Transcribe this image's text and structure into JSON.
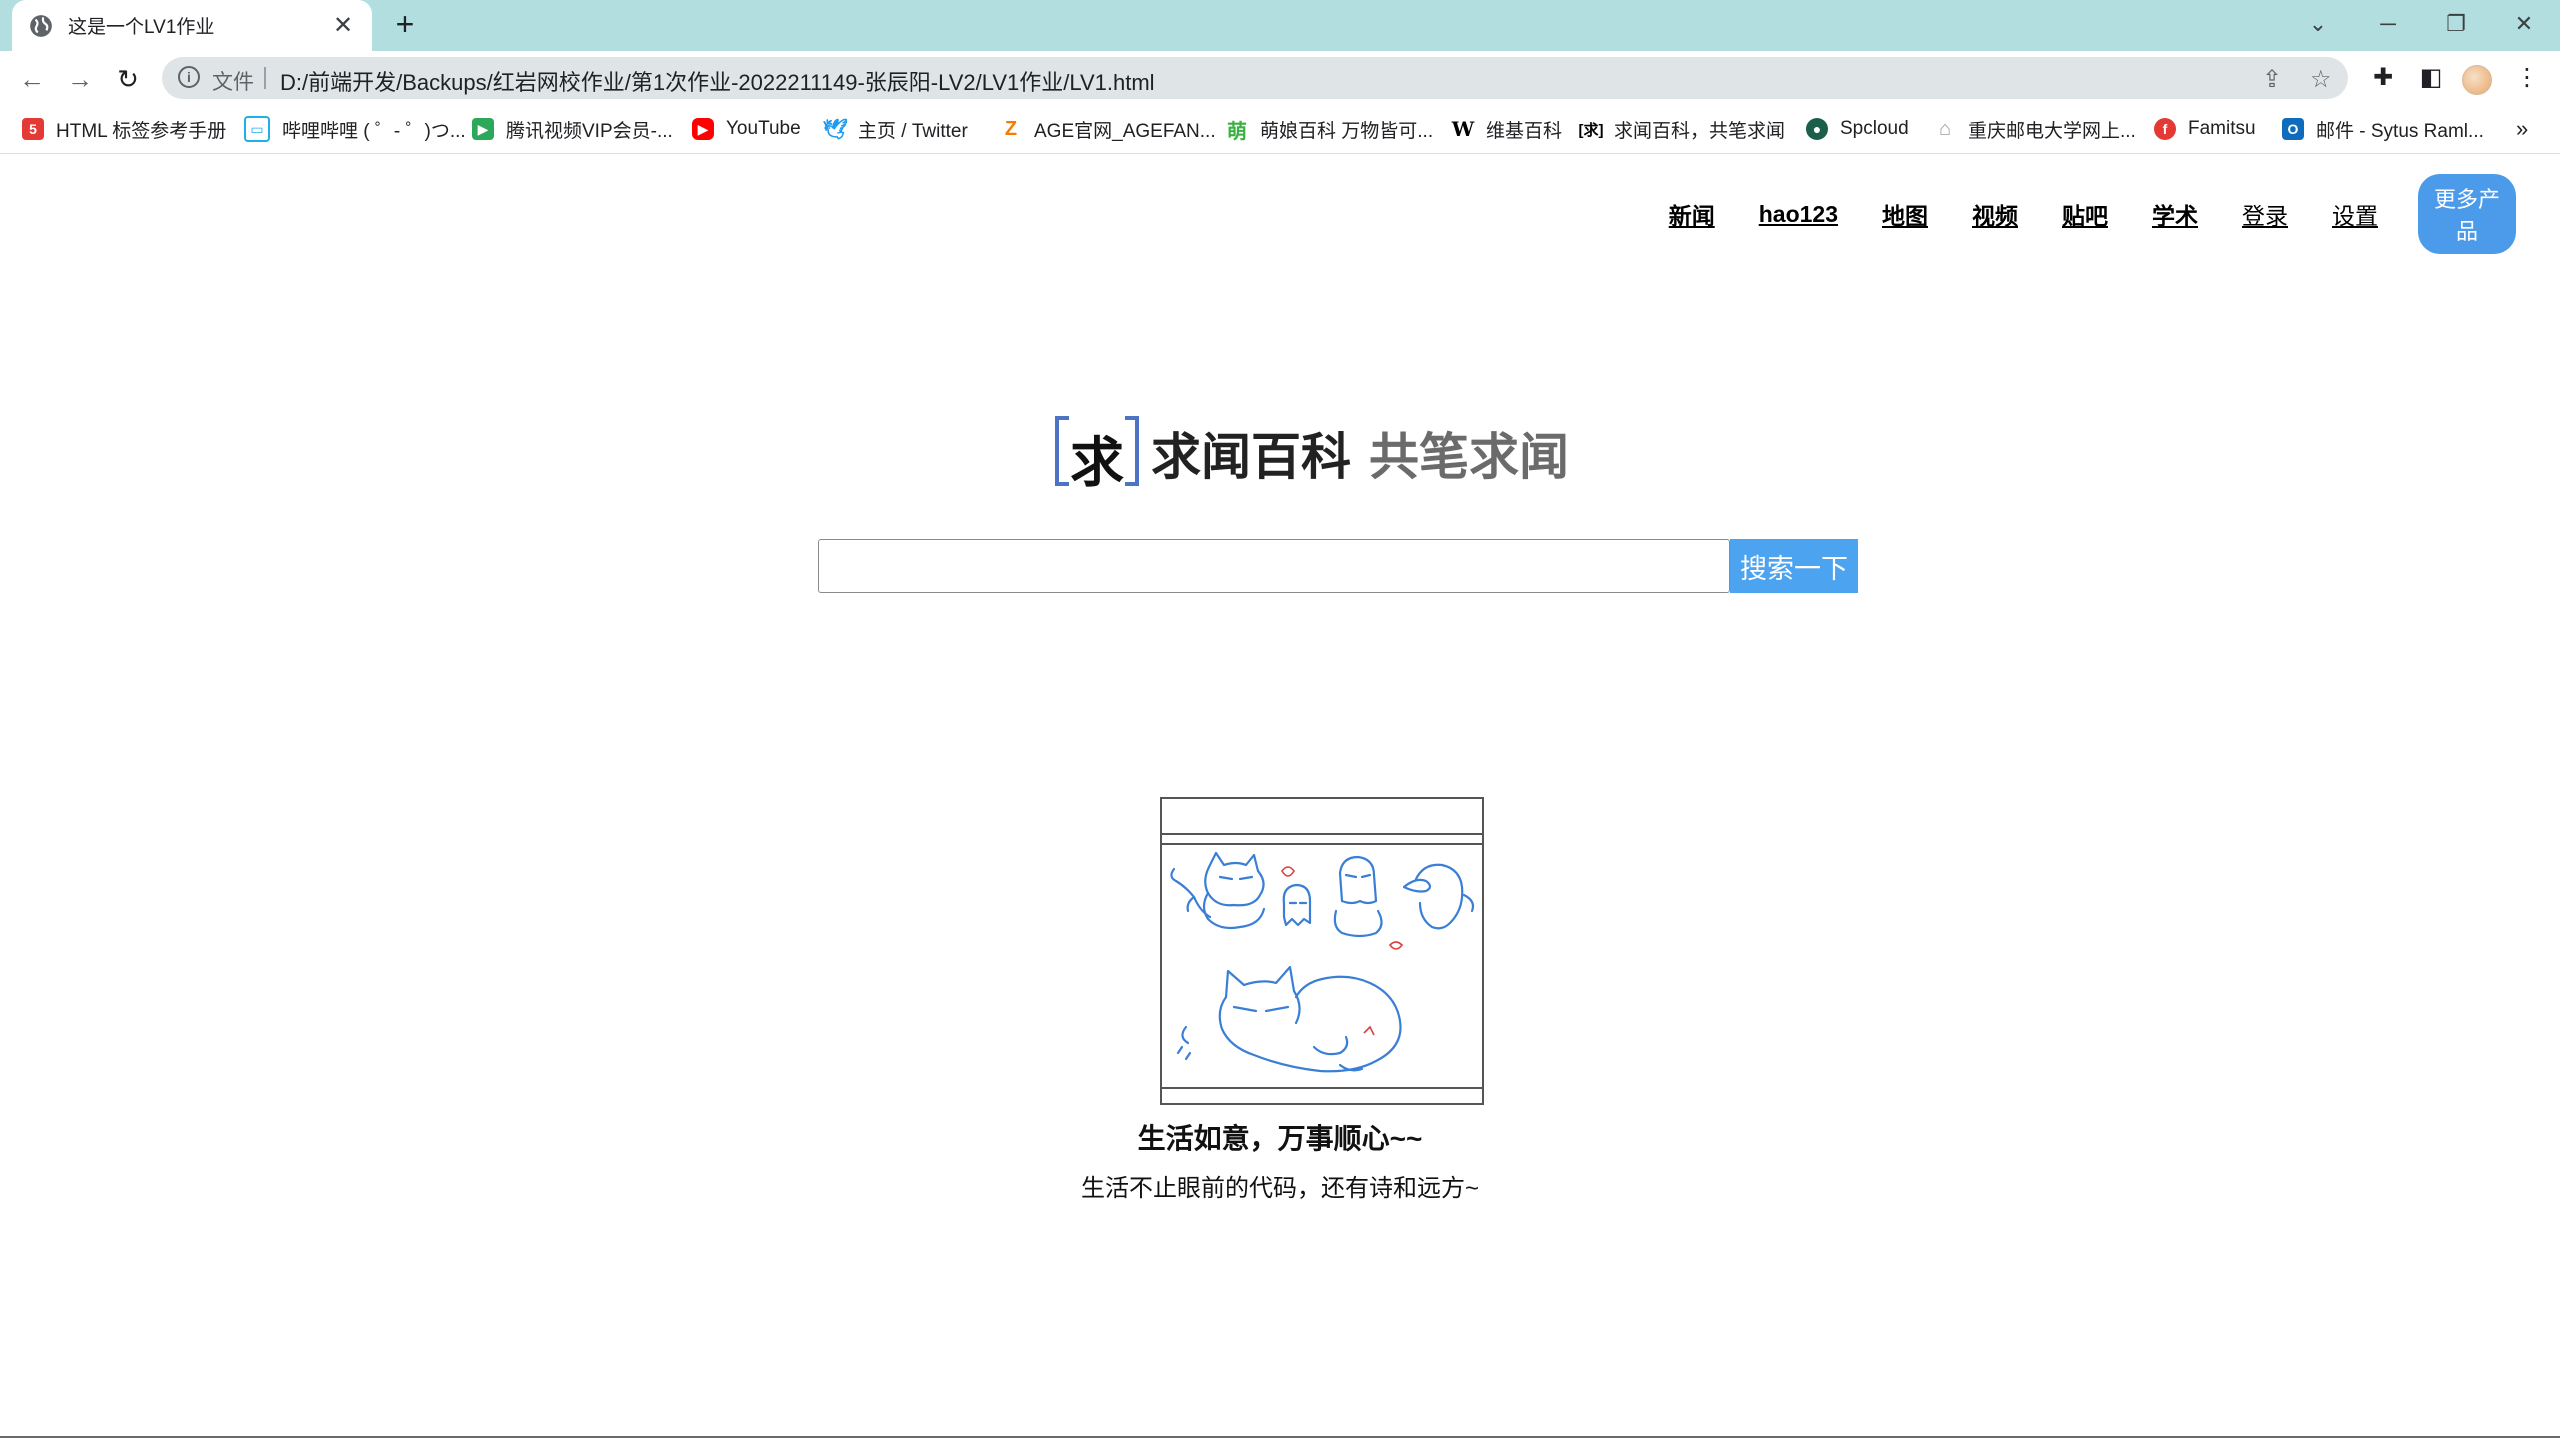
{
  "browser": {
    "tab_title": "这是一个LV1作业",
    "url_scheme_label": "文件",
    "url": "D:/前端开发/Backups/红岩网校作业/第1次作业-2022211149-张辰阳-LV2/LV1作业/LV1.html"
  },
  "bookmarks": [
    {
      "label": "HTML 标签参考手册",
      "icon": "html-ref-icon",
      "color": "#e53935"
    },
    {
      "label": "哔哩哔哩 ( ゜- ゜)つ...",
      "icon": "bilibili-icon",
      "color": "#23ade5"
    },
    {
      "label": "腾讯视频VIP会员-...",
      "icon": "tencent-video-icon",
      "color": "#2ca85a"
    },
    {
      "label": "YouTube",
      "icon": "youtube-icon",
      "color": "#ff0000"
    },
    {
      "label": "主页 / Twitter",
      "icon": "twitter-icon",
      "color": "#1d9bf0"
    },
    {
      "label": "AGE官网_AGEFAN...",
      "icon": "age-icon",
      "color": "#f57c00"
    },
    {
      "label": "萌娘百科 万物皆可...",
      "icon": "moegirl-icon",
      "color": "#3cb043"
    },
    {
      "label": "维基百科",
      "icon": "wikipedia-icon",
      "color": "#000000"
    },
    {
      "label": "求闻百科，共笔求闻",
      "icon": "qiuwen-icon",
      "color": "#4d73c4"
    },
    {
      "label": "Spcloud",
      "icon": "spcloud-icon",
      "color": "#1b5e4a"
    },
    {
      "label": "重庆邮电大学网上...",
      "icon": "cqupt-icon",
      "color": "#9e9e9e"
    },
    {
      "label": "Famitsu",
      "icon": "famitsu-icon",
      "color": "#e53935"
    },
    {
      "label": "邮件 - Sytus Raml...",
      "icon": "outlook-mail-icon",
      "color": "#0f6cbd"
    }
  ],
  "nav": {
    "links": [
      {
        "label": "新闻",
        "bold": true
      },
      {
        "label": "hao123",
        "bold": true
      },
      {
        "label": "地图",
        "bold": true
      },
      {
        "label": "视频",
        "bold": true
      },
      {
        "label": "贴吧",
        "bold": true
      },
      {
        "label": "学术",
        "bold": true
      },
      {
        "label": "登录",
        "bold": false
      },
      {
        "label": "设置",
        "bold": false
      }
    ],
    "more_label": "更多产品"
  },
  "logo": {
    "mark_char": "求",
    "name": "求闻百科",
    "slogan": "共笔求闻"
  },
  "search": {
    "value": "",
    "placeholder": "",
    "button_label": "搜索一下"
  },
  "content": {
    "caption": "生活如意，万事顺心~~",
    "subcaption": "生活不止眼前的代码，还有诗和远方~"
  },
  "colors": {
    "tabstrip": "#b3dedf",
    "accent_button": "#4ca3f0",
    "more_button": "#4c9bea",
    "logo_bracket": "#4d73c4",
    "sketch_line": "#3a7fd5"
  }
}
